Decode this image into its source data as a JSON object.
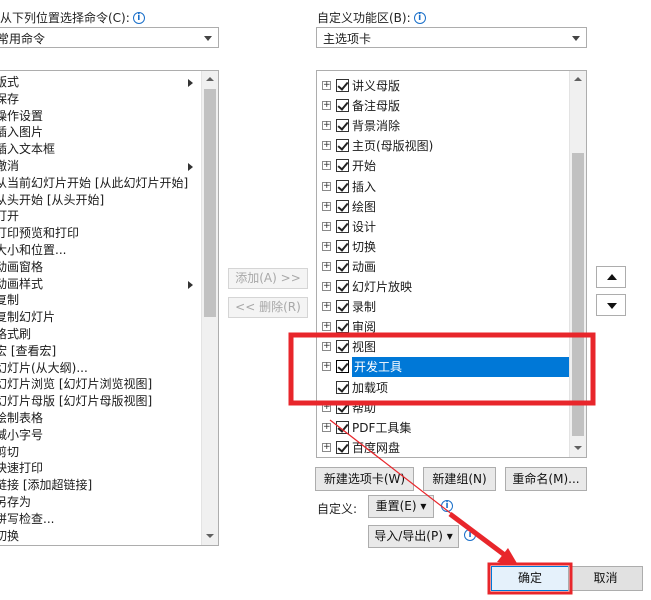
{
  "left": {
    "label": "从下列位置选择命令(C):",
    "combo_value": "常用命令",
    "items": [
      "版式",
      "保存",
      "操作设置",
      "插入图片",
      "插入文本框",
      "撤消",
      "从当前幻灯片开始 [从此幻灯片开始]",
      "从头开始 [从头开始]",
      "打开",
      "打印预览和打印",
      "大小和位置...",
      "动画窗格",
      "动画样式",
      "复制",
      "复制幻灯片",
      "格式刷",
      "宏 [查看宏]",
      "幻灯片(从大纲)...",
      "幻灯片浏览 [幻灯片浏览视图]",
      "幻灯片母版 [幻灯片母版视图]",
      "绘制表格",
      "减小字号",
      "剪切",
      "快速打印",
      "链接 [添加超链接]",
      "另存为",
      "拼写检查...",
      "切换"
    ]
  },
  "right": {
    "label": "自定义功能区(B):",
    "combo_value": "主选项卡",
    "tabs": [
      "讲义母版",
      "备注母版",
      "背景消除",
      "主页(母版视图)",
      "开始",
      "插入",
      "绘图",
      "设计",
      "切换",
      "动画",
      "幻灯片放映",
      "录制",
      "审阅",
      "视图",
      "开发工具",
      "加载项",
      "帮助",
      "PDF工具集",
      "百度网盘"
    ],
    "selected_tab": "开发工具"
  },
  "middle": {
    "add_label": "添加(A) >>",
    "remove_label": "<< 删除(R)"
  },
  "bottom": {
    "new_tab": "新建选项卡(W)",
    "new_group": "新建组(N)",
    "rename": "重命名(M)...",
    "customize_label": "自定义:",
    "reset": "重置(E) ▾",
    "import_export": "导入/导出(P) ▾",
    "ok": "确定",
    "cancel": "取消"
  },
  "colors": {
    "highlight": "#0078d7",
    "annotation": "#e8262b"
  }
}
